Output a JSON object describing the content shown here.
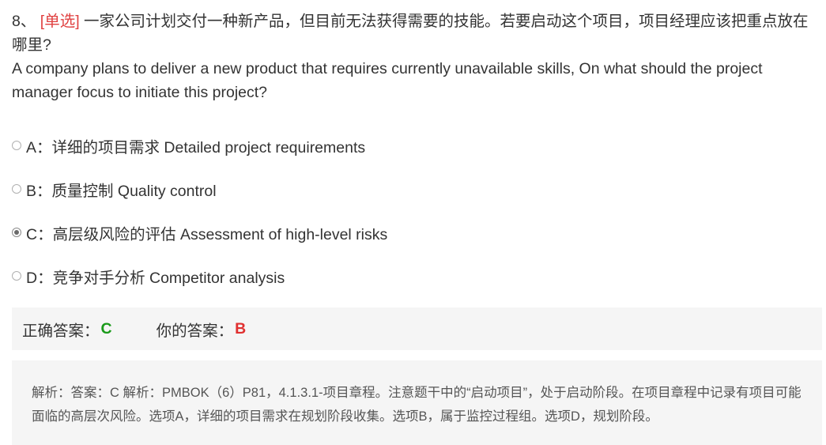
{
  "question": {
    "number": "8、",
    "tag": "[单选]",
    "text_cn": "一家公司计划交付一种新产品，但目前无法获得需要的技能。若要启动这个项目，项目经理应该把重点放在哪里?",
    "text_en": "A company plans to deliver a new product that requires currently unavailable skills, On what should the project manager focus to initiate this project?"
  },
  "options": [
    {
      "letter": "A",
      "text": "A：详细的项目需求 Detailed project requirements",
      "selected": false
    },
    {
      "letter": "B",
      "text": "B：质量控制 Quality control",
      "selected": false
    },
    {
      "letter": "C",
      "text": "C：高层级风险的评估 Assessment of high-level risks",
      "selected": true
    },
    {
      "letter": "D",
      "text": "D：竞争对手分析 Competitor analysis",
      "selected": false
    }
  ],
  "answer": {
    "correct_label": "正确答案：",
    "correct_value": "C",
    "your_label": "你的答案：",
    "your_value": "B",
    "correct_color": "#1a9a1a",
    "wrong_color": "#e03030"
  },
  "analysis": {
    "text": "解析：答案：C 解析：PMBOK（6）P81，4.1.3.1-项目章程。注意题干中的“启动项目”，处于启动阶段。在项目章程中记录有项目可能面临的高层次风险。选项A，详细的项目需求在规划阶段收集。选项B，属于监控过程组。选项D，规划阶段。"
  }
}
